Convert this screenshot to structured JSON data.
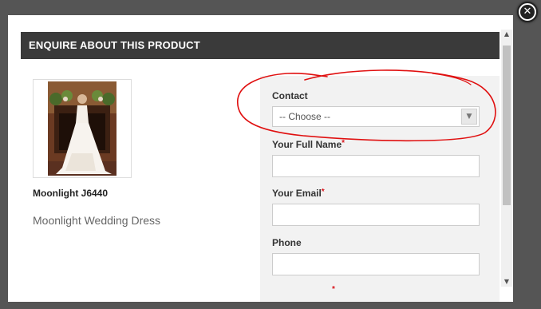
{
  "modal": {
    "title": "ENQUIRE ABOUT THIS PRODUCT",
    "close_icon": "✕"
  },
  "product": {
    "image_icon": "wedding-dress-photo",
    "name": "Moonlight J6440",
    "description": "Moonlight Wedding Dress"
  },
  "form": {
    "contact": {
      "label": "Contact",
      "selected": "-- Choose --",
      "arrow": "▼"
    },
    "full_name": {
      "label": "Your Full Name",
      "required": "*",
      "value": ""
    },
    "email": {
      "label": "Your Email",
      "required": "*",
      "value": ""
    },
    "phone": {
      "label": "Phone",
      "value": ""
    },
    "next_required": "*"
  },
  "scrollbar": {
    "up": "▲",
    "down": "▼"
  },
  "colors": {
    "overlay": "#555555",
    "title_bar": "#3a3a3a",
    "form_panel": "#f2f2f2",
    "required": "#d9141b",
    "annotation": "#e01010"
  }
}
